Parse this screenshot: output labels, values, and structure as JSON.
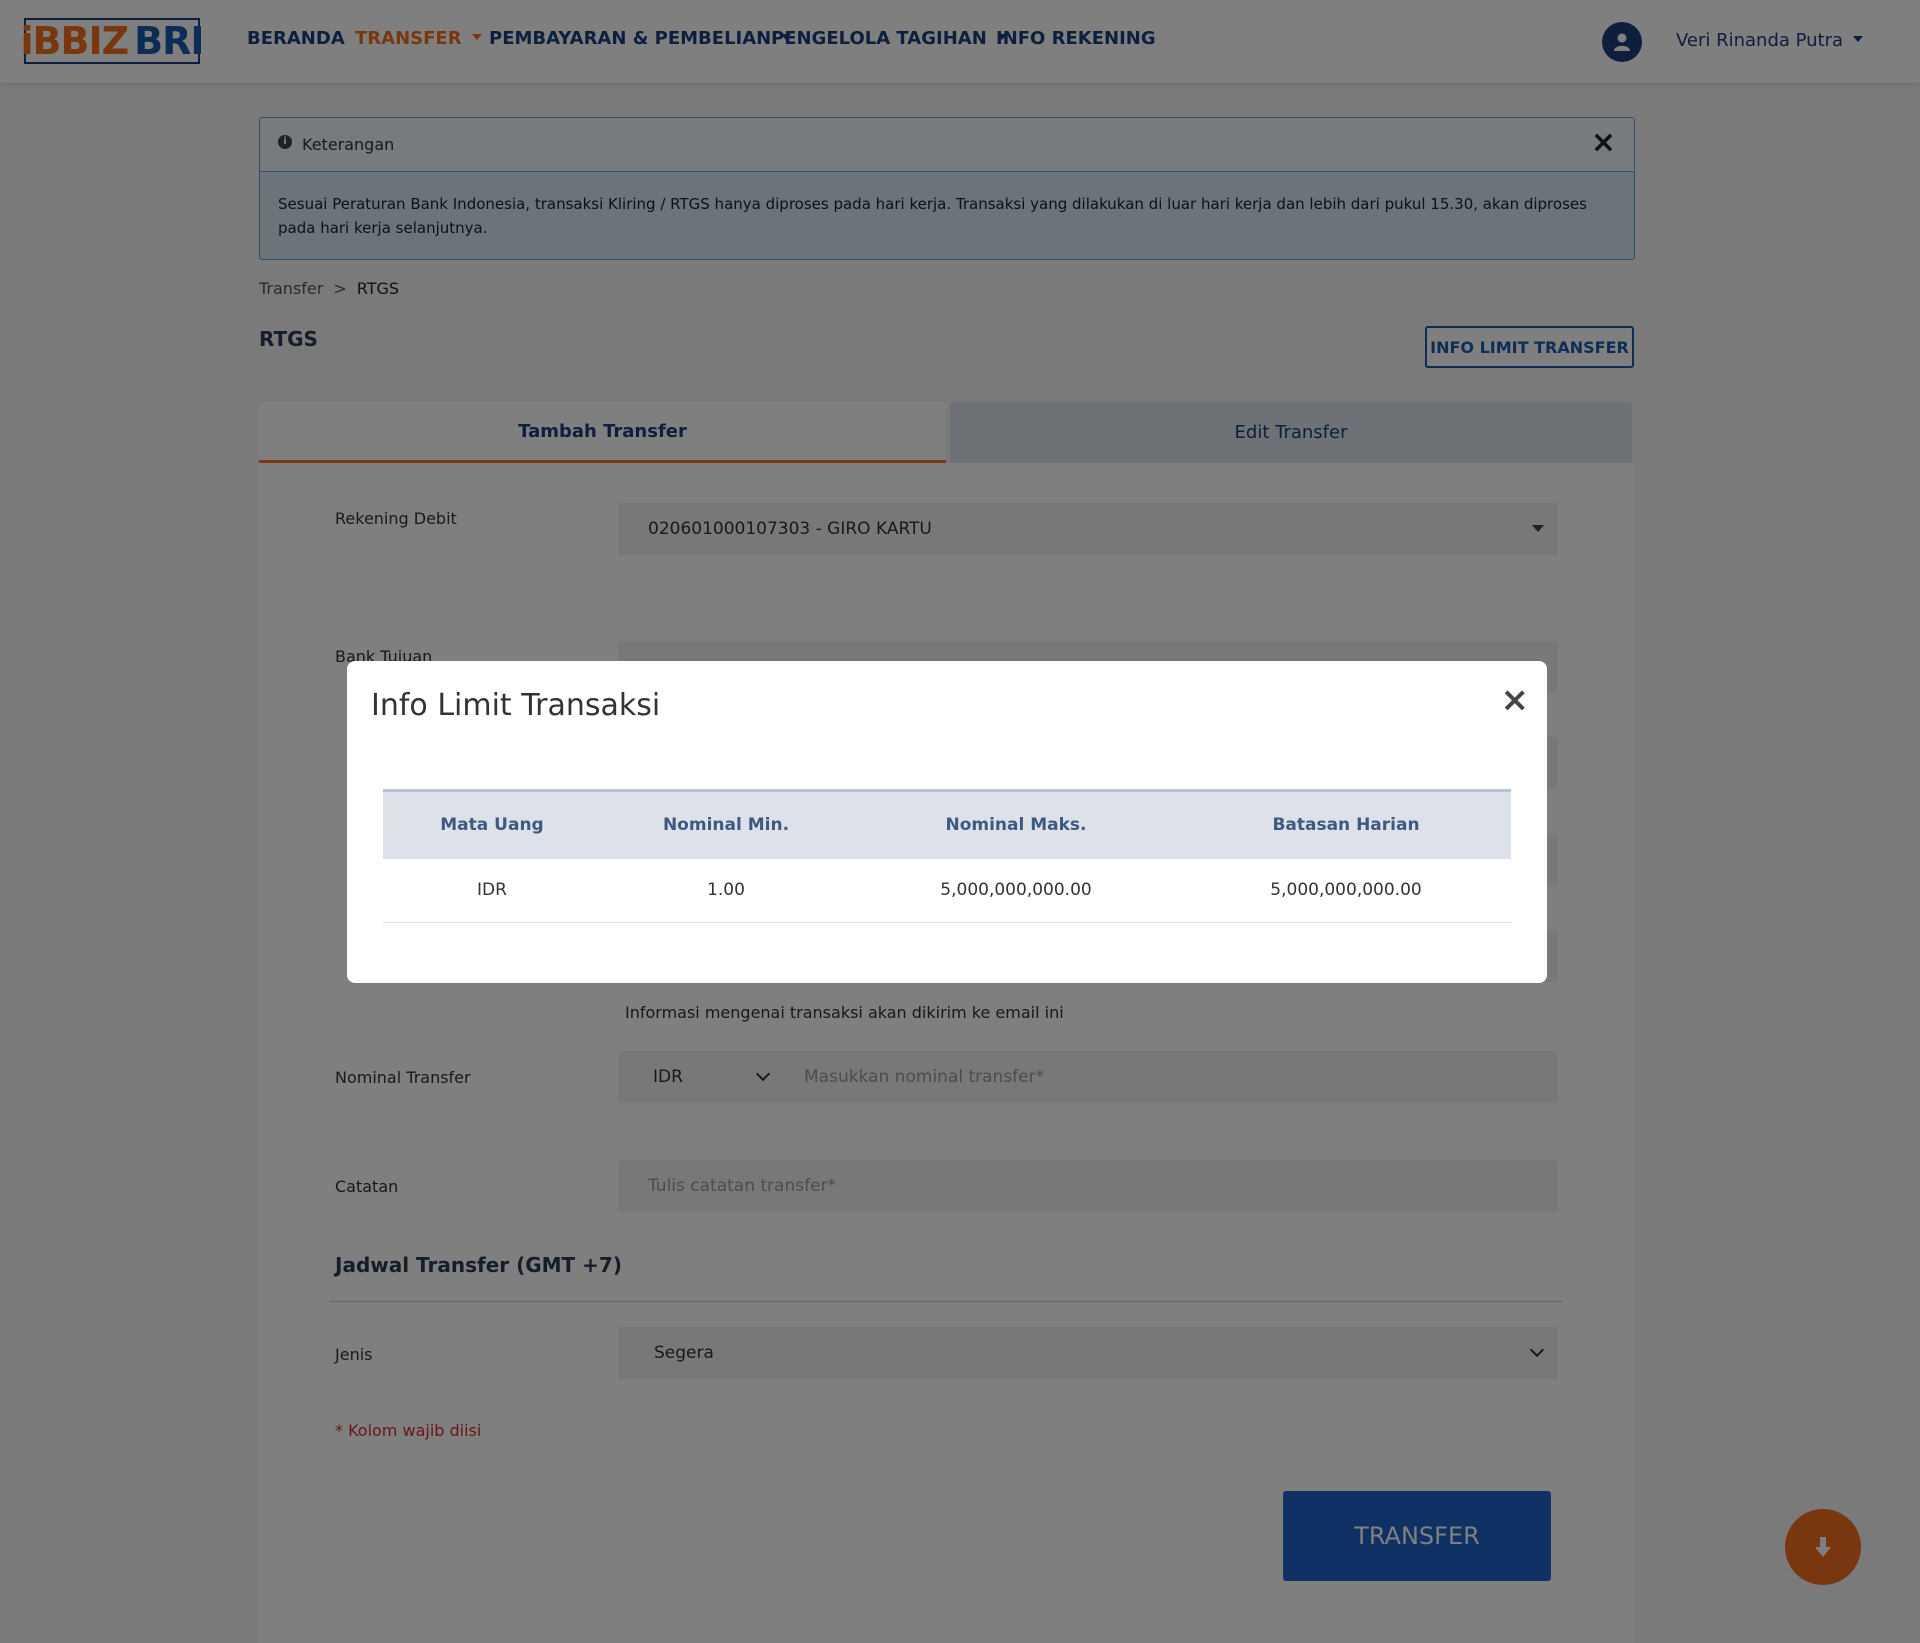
{
  "logo": {
    "part1": "iBBIZ",
    "part2": "BRI"
  },
  "nav": {
    "beranda": "BERANDA",
    "transfer": "TRANSFER",
    "pembayaran": "PEMBAYARAN & PEMBELIAN",
    "tagihan": "PENGELOLA TAGIHAN",
    "info_rekening": "INFO REKENING"
  },
  "user": {
    "name": "Veri Rinanda Putra"
  },
  "alert": {
    "title": "Keterangan",
    "body": "Sesuai Peraturan Bank Indonesia, transaksi Kliring / RTGS hanya diproses pada hari kerja. Transaksi yang dilakukan di luar hari kerja dan lebih dari pukul 15.30, akan diproses pada hari kerja selanjutnya."
  },
  "breadcrumb": {
    "root": "Transfer",
    "separator": ">",
    "current": "RTGS"
  },
  "page": {
    "title": "RTGS",
    "limit_button": "INFO LIMIT TRANSFER"
  },
  "tabs": {
    "add": "Tambah Transfer",
    "edit": "Edit Transfer"
  },
  "form": {
    "rekening_label": "Rekening Debit",
    "rekening_value": "020601000107303 - GIRO KARTU",
    "bank_label": "Bank Tujuan",
    "email_note": "Informasi mengenai transaksi akan dikirim ke email ini",
    "nominal_label": "Nominal Transfer",
    "currency": "IDR",
    "nominal_placeholder": "Masukkan nominal transfer*",
    "catatan_label": "Catatan",
    "catatan_placeholder": "Tulis catatan transfer*",
    "schedule_title": "Jadwal Transfer (GMT +7)",
    "jenis_label": "Jenis",
    "jenis_value": "Segera",
    "required_note": "* Kolom wajib diisi",
    "submit": "TRANSFER"
  },
  "modal": {
    "title": "Info Limit Transaksi",
    "columns": [
      "Mata Uang",
      "Nominal Min.",
      "Nominal Maks.",
      "Batasan Harian"
    ],
    "rows": [
      [
        "IDR",
        "1.00",
        "5,000,000,000.00",
        "5,000,000,000.00"
      ]
    ]
  },
  "colors": {
    "brand_orange": "#f26f21",
    "brand_blue": "#1a3f7a",
    "button_blue": "#1f63c7"
  }
}
